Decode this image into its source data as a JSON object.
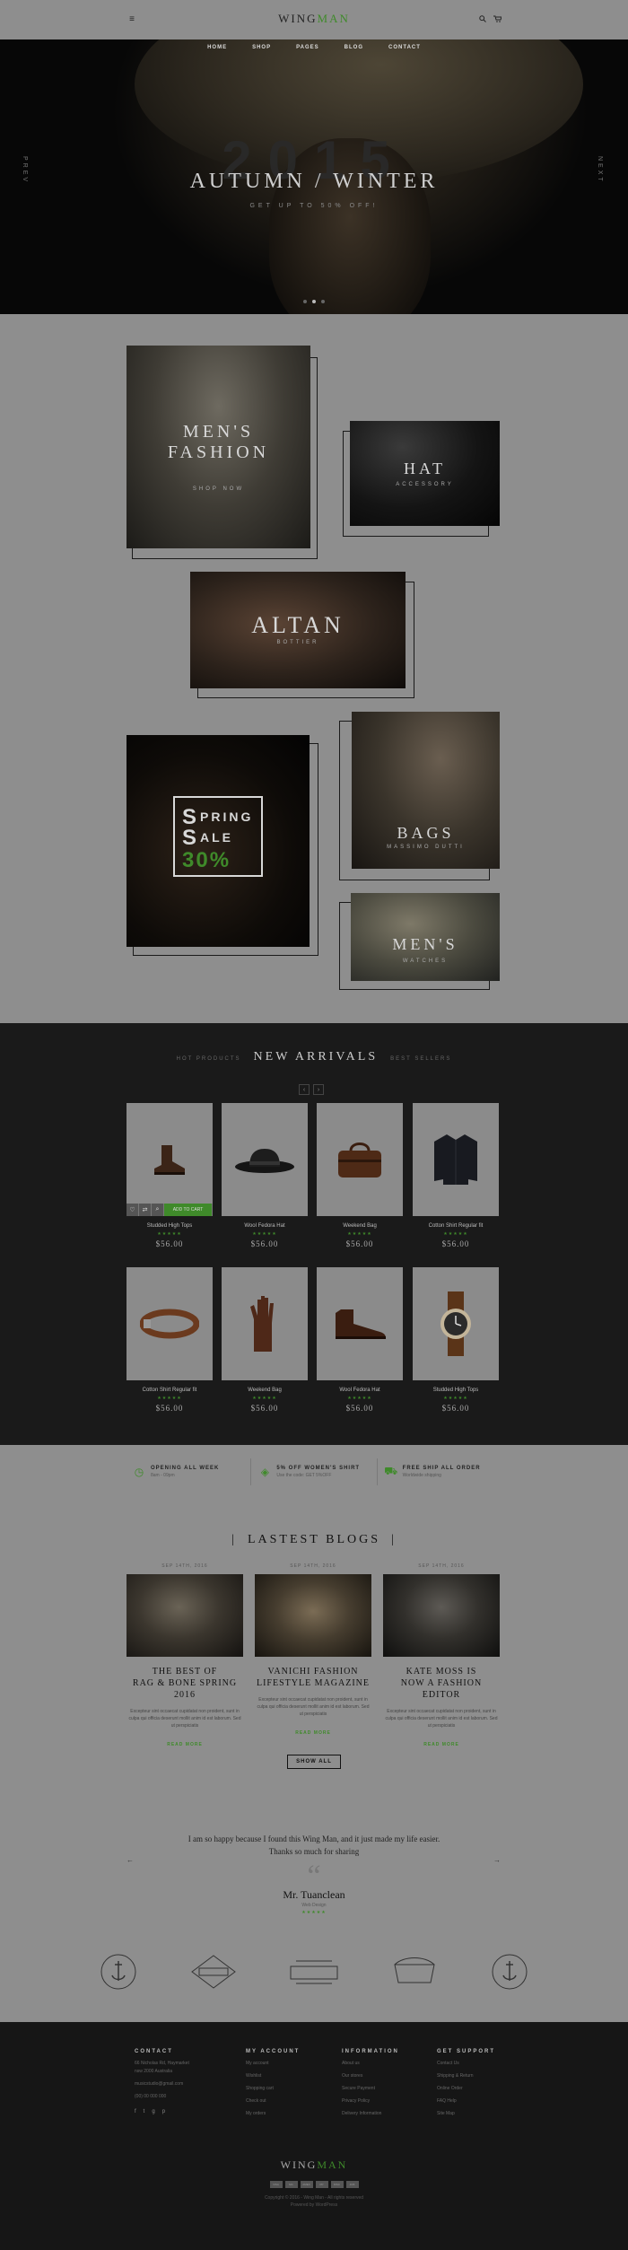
{
  "header": {
    "logo_a": "WING",
    "logo_b": "MAN",
    "nav": [
      "HOME",
      "SHOP",
      "PAGES",
      "BLOG",
      "CONTACT"
    ]
  },
  "hero": {
    "year": "2015",
    "title": "AUTUMN / WINTER",
    "subtitle": "GET UP TO 50% OFF!",
    "prev": "PREV",
    "next": "NEXT"
  },
  "collections": {
    "men": {
      "title_1": "MEN'S",
      "title_2": "FASHION",
      "sub": "SHOP NOW"
    },
    "hat": {
      "title": "HAT",
      "sub": "ACCESSORY"
    },
    "altan": {
      "title": "ALTAN",
      "sub": "BOTTIER"
    },
    "spring": {
      "line1": "PRING",
      "line2": "ALE",
      "cap1": "S",
      "cap2": "S",
      "pct": "30%"
    },
    "bags": {
      "title": "BAGS",
      "sub": "MASSIMO DUTTI"
    },
    "watches": {
      "title": "MEN'S",
      "sub": "WATCHES"
    }
  },
  "arrivals": {
    "tab_left": "HOT PRODUCTS",
    "tab_main": "NEW ARRIVALS",
    "tab_right": "BEST SELLERS",
    "prev": "‹",
    "next": "›",
    "add_to_cart": "ADD TO CART",
    "products": [
      {
        "name": "Studded High Tops",
        "price": "$56.00",
        "icon": "boot-icon"
      },
      {
        "name": "Wool Fedora Hat",
        "price": "$56.00",
        "icon": "hat-icon"
      },
      {
        "name": "Weekend Bag",
        "price": "$56.00",
        "icon": "bag-icon"
      },
      {
        "name": "Cotton Shirt Regular fit",
        "price": "$56.00",
        "icon": "jacket-icon"
      },
      {
        "name": "Cotton Shirt Regular fit",
        "price": "$56.00",
        "icon": "belt-icon"
      },
      {
        "name": "Weekend Bag",
        "price": "$56.00",
        "icon": "gloves-icon"
      },
      {
        "name": "Wool Fedora Hat",
        "price": "$56.00",
        "icon": "boot-icon"
      },
      {
        "name": "Studded High Tops",
        "price": "$56.00",
        "icon": "watch-icon"
      }
    ],
    "stars": "★★★★★"
  },
  "features": [
    {
      "title": "OPENING ALL WEEK",
      "sub": "8am - 09pm",
      "icon": "clock-icon"
    },
    {
      "title": "5% OFF WOMEN'S SHIRT",
      "sub": "Use the code: GET 5%OFF",
      "icon": "tag-icon"
    },
    {
      "title": "FREE SHIP ALL ORDER",
      "sub": "Worldwide shipping",
      "icon": "truck-icon"
    }
  ],
  "blogs": {
    "title": "LASTEST BLOGS",
    "items": [
      {
        "date": "SEP 14TH, 2016",
        "h1": "THE BEST OF",
        "h2": "RAG & BONE SPRING 2016",
        "excerpt": "Excepteur sint occaecat cupidatat non proident, sunt in culpa qui officia deserunt mollit anim id est laborum. Sed ut perspiciatis",
        "more": "READ MORE"
      },
      {
        "date": "SEP 14TH, 2016",
        "h1": "VANICHI FASHION",
        "h2": "LIFESTYLE MAGAZINE",
        "excerpt": "Excepteur sint occaecat cupidatat non proident, sunt in culpa qui officia deserunt mollit anim id est laborum. Sed ut perspiciatis",
        "more": "READ MORE"
      },
      {
        "date": "SEP 14TH, 2016",
        "h1": "KATE MOSS IS",
        "h2": "NOW A FASHION EDITOR",
        "excerpt": "Excepteur sint occaecat cupidatat non proident, sunt in culpa qui officia deserunt mollit anim id est laborum. Sed ut perspiciatis",
        "more": "READ MORE"
      }
    ],
    "show_all": "SHOW ALL"
  },
  "testimonial": {
    "line1": "I am so happy because I found this Wing Man, and it just made my life easier.",
    "line2": "Thanks so much for sharing",
    "name": "Mr. Tuanclean",
    "role": "Web Design",
    "stars": "★★★★★",
    "prev": "←",
    "next": "→"
  },
  "brands": [
    "VINTAGE",
    "HIPSTER",
    "John",
    "SUPPERSHOW",
    "VINTAGE"
  ],
  "footer": {
    "cols": [
      {
        "title": "CONTACT",
        "lines": [
          "66 Nicholas Rd, Haymarket",
          "nsw 2000 Australia",
          "musicstudio@gmail.com",
          "(00) 00 000 000"
        ]
      },
      {
        "title": "MY ACCOUNT",
        "lines": [
          "My account",
          "Wishlist",
          "Shopping cart",
          "Check out",
          "My orders"
        ]
      },
      {
        "title": "INFORMATION",
        "lines": [
          "About us",
          "Our stores",
          "Secure Payment",
          "Privacy Policy",
          "Delivery Information"
        ]
      },
      {
        "title": "GET SUPPORT",
        "lines": [
          "Contact Us",
          "Shipping & Return",
          "Online Order",
          "FAQ Help",
          "Site Map"
        ]
      }
    ],
    "social": [
      "f",
      "t",
      "g",
      "p"
    ],
    "logo_a": "WING",
    "logo_b": "MAN",
    "payments": [
      "VISA",
      "MC",
      "AMEX",
      "PP",
      "DISC",
      "JCB"
    ],
    "copy1": "Copyright © 2016 - Wing Man - All rights reserved",
    "copy2": "Powered by WordPress"
  },
  "colors": {
    "accent": "#3f8a2a",
    "dark": "#1a1a1a",
    "page": "#8e8e8e"
  }
}
